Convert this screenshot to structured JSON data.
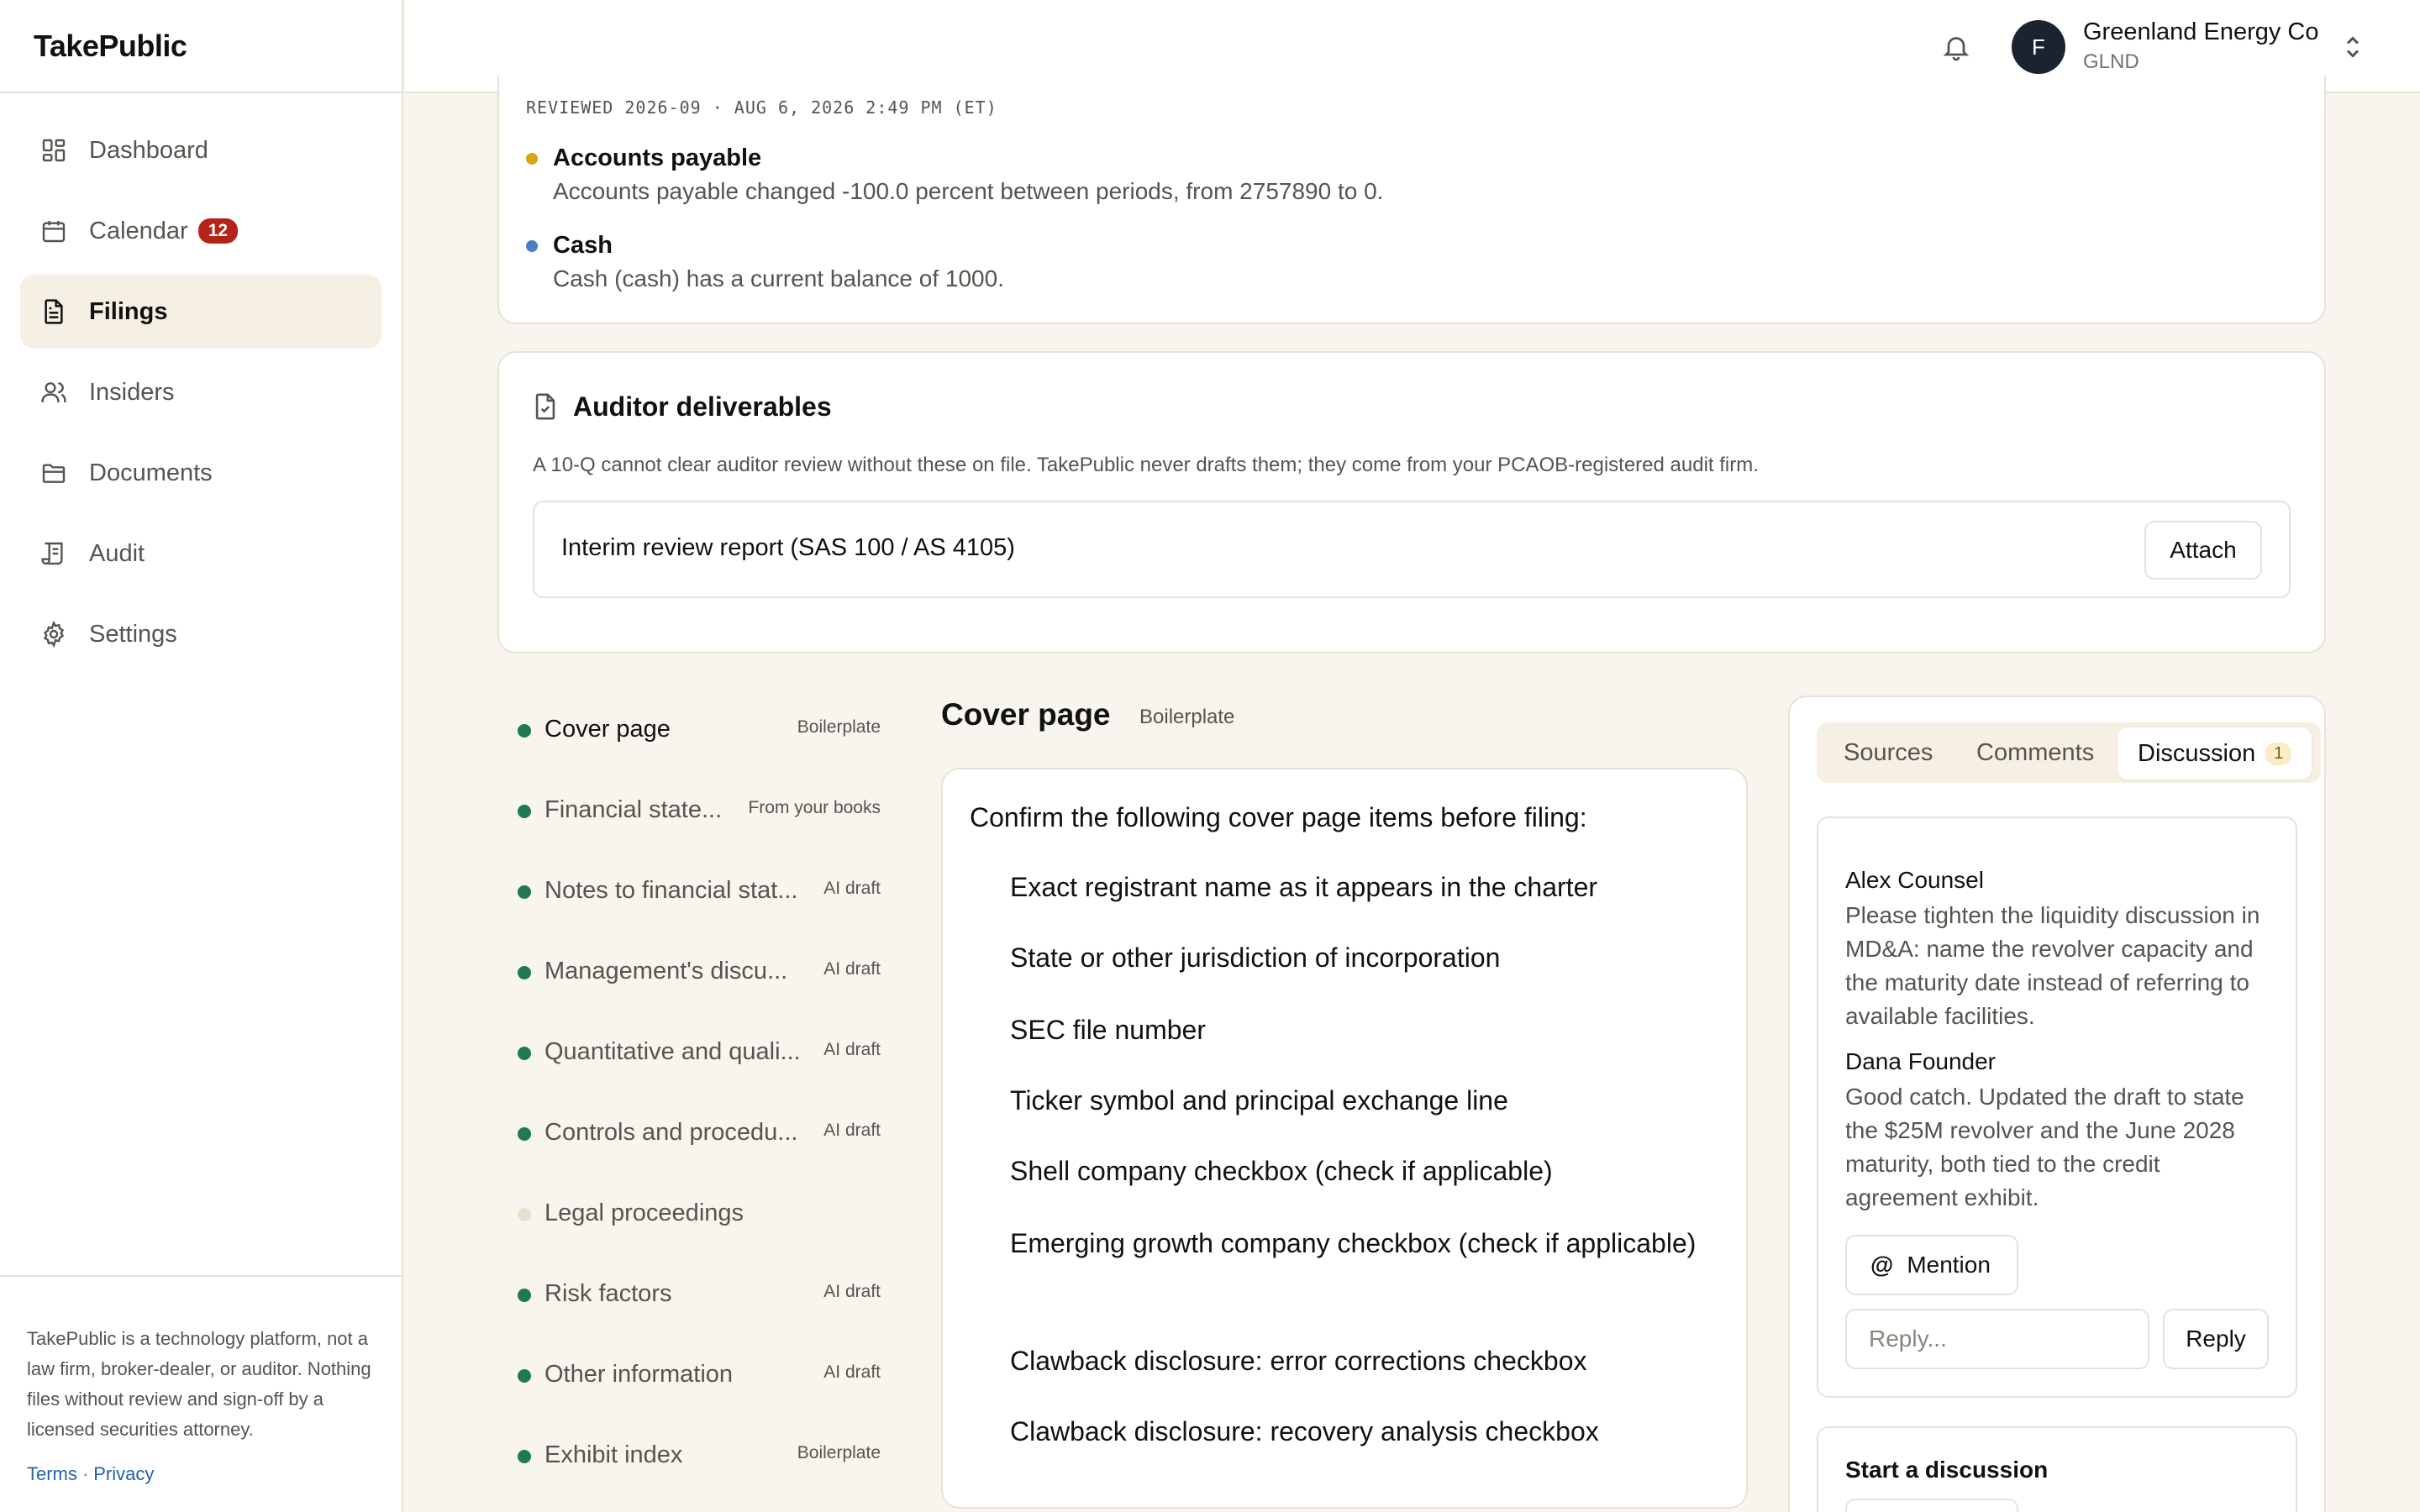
{
  "app": {
    "name": "TakePublic"
  },
  "sidebar": {
    "items": [
      {
        "label": "Dashboard",
        "icon": "dashboard-icon"
      },
      {
        "label": "Calendar",
        "icon": "calendar-icon",
        "badge": "12"
      },
      {
        "label": "Filings",
        "icon": "file-text-icon",
        "active": true
      },
      {
        "label": "Insiders",
        "icon": "users-icon"
      },
      {
        "label": "Documents",
        "icon": "folder-icon"
      },
      {
        "label": "Audit",
        "icon": "scroll-icon"
      },
      {
        "label": "Settings",
        "icon": "gear-icon"
      }
    ],
    "disclaimer": "TakePublic is a technology platform, not a law firm, broker-dealer, or auditor. Nothing files without review and sign-off by a licensed securities attorney.",
    "links": {
      "terms": "Terms",
      "separator": "·",
      "privacy": "Privacy"
    }
  },
  "topbar": {
    "company_name": "Greenland Energy Co",
    "ticker": "GLND",
    "avatar_initial": "F"
  },
  "review": {
    "reviewed_line": "REVIEWED 2026-09 · AUG 6, 2026 2:49 PM (ET)",
    "findings": [
      {
        "title": "Accounts payable",
        "description": "Accounts payable changed -100.0 percent between periods, from 2757890 to 0.",
        "color": "#d9a514"
      },
      {
        "title": "Cash",
        "description": "Cash (cash) has a current balance of 1000.",
        "color": "#4a7fc1"
      }
    ]
  },
  "auditor": {
    "title": "Auditor deliverables",
    "description": "A 10-Q cannot clear auditor review without these on file. TakePublic never drafts them; they come from your PCAOB-registered audit firm.",
    "deliverable": "Interim review report (SAS 100 / AS 4105)",
    "attach_label": "Attach"
  },
  "sections": [
    {
      "label": "Cover page",
      "tag": "Boilerplate",
      "status": "done",
      "active": true
    },
    {
      "label": "Financial state...",
      "tag": "From your books",
      "status": "done"
    },
    {
      "label": "Notes to financial stat...",
      "tag": "AI draft",
      "status": "done"
    },
    {
      "label": "Management's discu...",
      "tag": "AI draft",
      "status": "done"
    },
    {
      "label": "Quantitative and quali...",
      "tag": "AI draft",
      "status": "done"
    },
    {
      "label": "Controls and procedu...",
      "tag": "AI draft",
      "status": "done"
    },
    {
      "label": "Legal proceedings",
      "tag": "",
      "status": "pending"
    },
    {
      "label": "Risk factors",
      "tag": "AI draft",
      "status": "done"
    },
    {
      "label": "Other information",
      "tag": "AI draft",
      "status": "done"
    },
    {
      "label": "Exhibit index",
      "tag": "Boilerplate",
      "status": "done"
    }
  ],
  "editor": {
    "title": "Cover page",
    "tag": "Boilerplate",
    "intro": "Confirm the following cover page items before filing:",
    "items": [
      "Exact registrant name as it appears in the charter",
      "State or other jurisdiction of incorporation",
      "SEC file number",
      "Ticker symbol and principal exchange line",
      "Shell company checkbox (check if applicable)",
      "Emerging growth company checkbox (check if applicable)",
      "Clawback disclosure: error corrections checkbox",
      "Clawback disclosure: recovery analysis checkbox"
    ]
  },
  "panel": {
    "tabs": [
      {
        "label": "Sources"
      },
      {
        "label": "Comments"
      },
      {
        "label": "Discussion",
        "count": "1",
        "active": true
      }
    ],
    "comments": [
      {
        "author": "Alex Counsel",
        "body": "Please tighten the liquidity discussion in MD&A: name the revolver capacity and the maturity date instead of referring to available facilities."
      },
      {
        "author": "Dana Founder",
        "body": "Good catch. Updated the draft to state the $25M revolver and the June 2028 maturity, both tied to the credit agreement exhibit."
      }
    ],
    "mention_label": "Mention",
    "mention_symbol": "@",
    "reply_placeholder": "Reply...",
    "reply_label": "Reply",
    "start_title": "Start a discussion"
  }
}
